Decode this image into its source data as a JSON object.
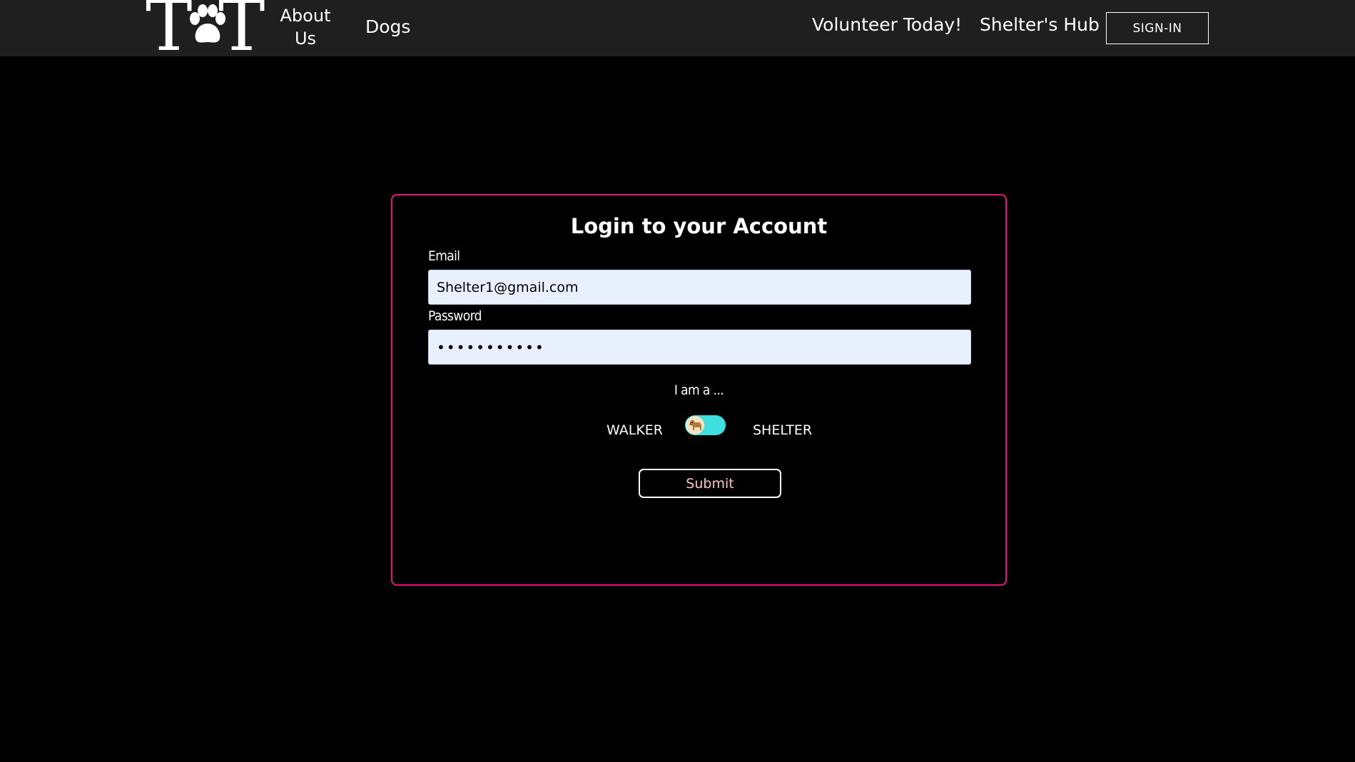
{
  "colors": {
    "navbar_bg": "#1f1f1f",
    "page_bg": "#000000",
    "card_border": "#e6127f",
    "input_bg": "#e8f0fe",
    "toggle_bg": "#3ee0df",
    "submit_text": "#ffc0cb"
  },
  "nav": {
    "logo_letter_left": "T",
    "logo_letter_right": "T",
    "logo_icon": "paw-icon",
    "about_label": "About Us",
    "dogs_label": "Dogs",
    "volunteer_label": "Volunteer Today!",
    "hub_label": "Shelter's Hub",
    "signin_label": "SIGN-IN"
  },
  "login": {
    "title": "Login to your Account",
    "email_label": "Email",
    "email_value": "Shelter1@gmail.com",
    "password_label": "Password",
    "password_value": "•••••••••••",
    "role_prompt": "I am a ...",
    "role_left": "WALKER",
    "role_right": "SHELTER",
    "toggle_icon": "dog-icon",
    "toggle_state": "on",
    "submit_label": "Submit"
  }
}
